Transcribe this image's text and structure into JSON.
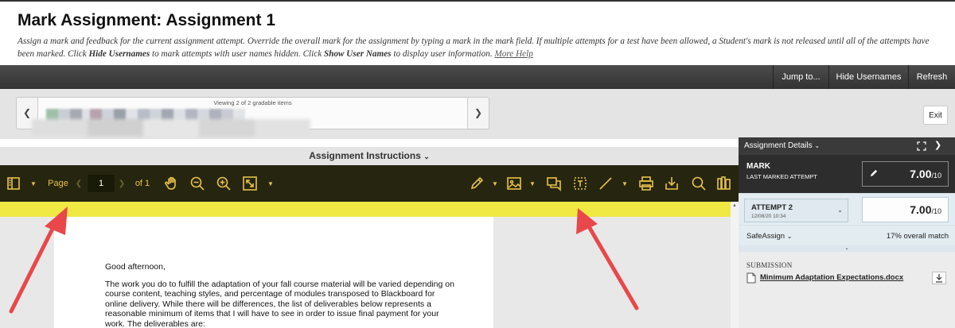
{
  "header": {
    "title": "Mark Assignment: Assignment 1",
    "desc_1": "Assign a mark and feedback for the current assignment attempt. Override the overall mark for the assignment by typing a mark in the mark field. If multiple attempts for a test have been allowed, a Student's mark is not released until all of the attempts have been marked. Click ",
    "desc_hide": "Hide Usernames",
    "desc_2": " to mark attempts with user names hidden. Click ",
    "desc_show": "Show User Names",
    "desc_3": " to display user information. ",
    "more_help": "More Help"
  },
  "actionbar": {
    "jump": "Jump to...",
    "hide_usernames": "Hide Usernames",
    "refresh": "Refresh"
  },
  "nav": {
    "viewing": "Viewing 2 of 2 gradable items",
    "exit": "Exit"
  },
  "instructions": {
    "label": "Assignment Instructions"
  },
  "toolbar": {
    "page_label": "Page",
    "page_value": "1",
    "page_of": "of 1"
  },
  "document": {
    "greeting": "Good afternoon,",
    "paragraph": "The work you do to fulfill the adaptation of your fall course material will be varied depending on course content, teaching styles, and percentage of modules transposed to Blackboard for online delivery. While there will be differences, the list of deliverables below represents a reasonable minimum of items that I will have to see in order to issue final payment for your work. The deliverables are:"
  },
  "panel": {
    "title": "Assignment Details",
    "mark_label": "MARK",
    "mark_sub": "LAST MARKED ATTEMPT",
    "mark_value": "7.00",
    "mark_max": "/10",
    "attempt_label": "ATTEMPT 2",
    "attempt_date": "12/08/20 10:34",
    "attempt_value": "7.00",
    "attempt_max": "/10",
    "safeassign": "SafeAssign",
    "match": "17% overall match",
    "submission_label": "SUBMISSION",
    "file_name": "Minimum Adaptation Expectations.docx"
  },
  "colors": {
    "toolbar_bg": "#262610",
    "toolbar_icon": "#e8c14a",
    "highlight_strip": "#f0e843",
    "arrow": "#e8484a"
  }
}
